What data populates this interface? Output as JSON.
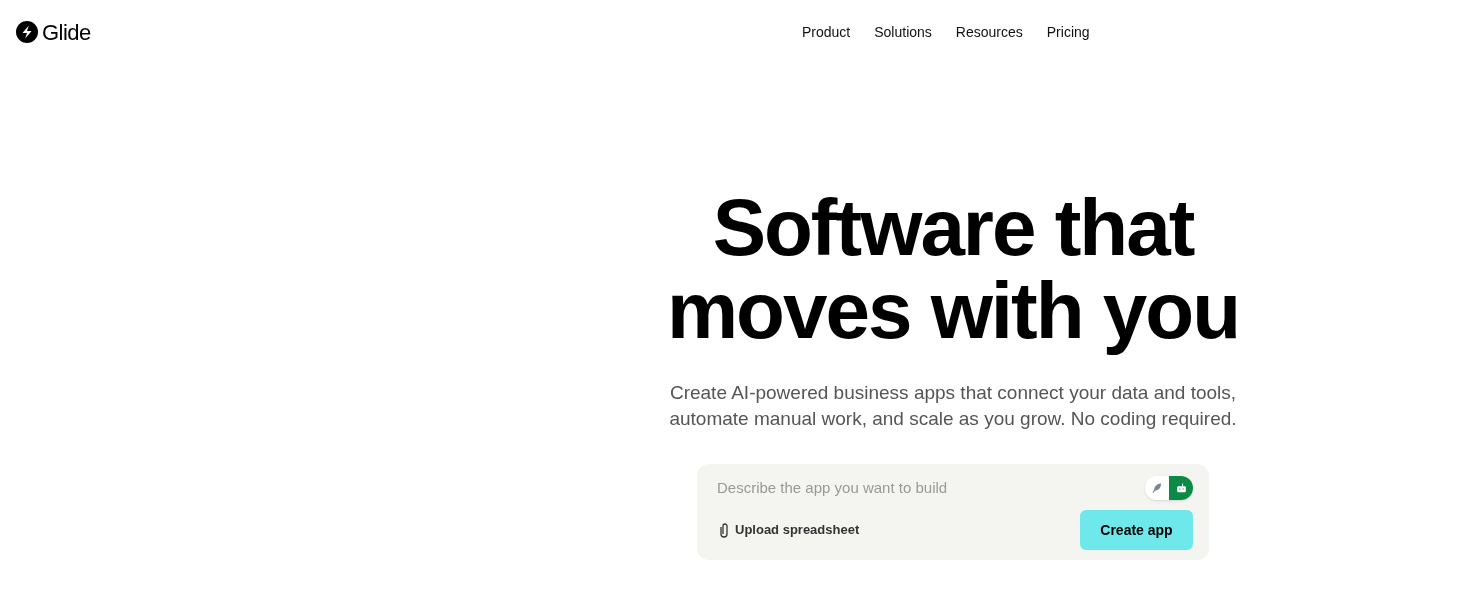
{
  "logo": {
    "name": "Glide"
  },
  "nav": [
    "Product",
    "Solutions",
    "Resources",
    "Pricing"
  ],
  "hero": {
    "title_lines": [
      "Software that",
      "moves with you"
    ],
    "subtitle_lines": [
      "Create AI-powered business apps that connect your data and tools,",
      "automate manual work, and scale as you grow. No coding required."
    ]
  },
  "prompt": {
    "placeholder": "Describe the app you want to build",
    "modes": [
      {
        "kind": "feather",
        "selected": false
      },
      {
        "kind": "robot",
        "selected": true
      }
    ],
    "upload": "Upload spreadsheet",
    "submit": "Create app"
  }
}
